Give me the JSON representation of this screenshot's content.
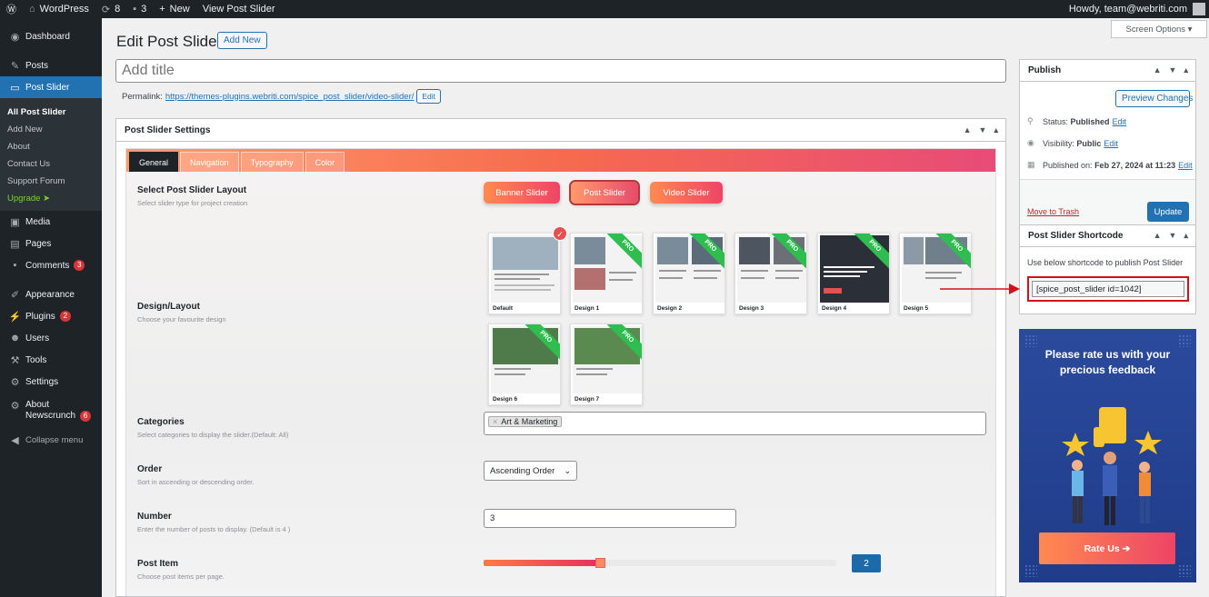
{
  "adminbar": {
    "site_name": "WordPress",
    "updates_count": "8",
    "comments_count": "3",
    "new_label": "New",
    "view_label": "View Post Slider",
    "howdy": "Howdy, team@webriti.com"
  },
  "sidebar": {
    "dashboard": "Dashboard",
    "posts": "Posts",
    "post_slider": "Post Slider",
    "submenu": [
      "All Post Slider",
      "Add New",
      "About",
      "Contact Us",
      "Support Forum",
      "Upgrade"
    ],
    "media": "Media",
    "pages": "Pages",
    "comments": "Comments",
    "comments_badge": "3",
    "appearance": "Appearance",
    "plugins": "Plugins",
    "plugins_badge": "2",
    "users": "Users",
    "tools": "Tools",
    "settings": "Settings",
    "about_newscrunch_1": "About",
    "about_newscrunch_2": "Newscrunch",
    "about_badge": "6",
    "collapse": "Collapse menu"
  },
  "header": {
    "title": "Edit Post Slider",
    "add_new": "Add New",
    "screen_options": "Screen Options"
  },
  "title_input": {
    "placeholder": "Add title"
  },
  "permalink": {
    "label": "Permalink:",
    "url": "https://themes-plugins.webriti.com/spice_post_slider/video-slider/",
    "edit": "Edit"
  },
  "settings": {
    "box_title": "Post Slider Settings",
    "tabs": [
      "General",
      "Navigation",
      "Typography",
      "Color"
    ],
    "layout_label": "Select Post Slider Layout",
    "layout_desc": "Select slider type for project creation",
    "layout_buttons": [
      "Banner Slider",
      "Post Slider",
      "Video Slider"
    ],
    "design_label": "Design/Layout",
    "design_desc": "Choose your favourite design",
    "designs": [
      "Default",
      "Design 1",
      "Design 2",
      "Design 3",
      "Design 4",
      "Design 5",
      "Design 6",
      "Design 7"
    ],
    "pro_label": "PRO",
    "categories_label": "Categories",
    "categories_desc": "Select categories to display the slider.(Default: All)",
    "category_tag": "Art & Marketing",
    "order_label": "Order",
    "order_desc": "Sort in ascending or descending order.",
    "order_value": "Ascending Order",
    "number_label": "Number",
    "number_desc": "Enter the number of posts to display. (Default is 4 )",
    "number_value": "3",
    "post_item_label": "Post Item",
    "post_item_desc": "Choose post items per page.",
    "post_item_value": "2",
    "post_item_fraction": 0.33
  },
  "publish": {
    "title": "Publish",
    "preview": "Preview Changes",
    "status_label": "Status:",
    "status_value": "Published",
    "visibility_label": "Visibility:",
    "visibility_value": "Public",
    "published_label": "Published on:",
    "published_value": "Feb 27, 2024 at 11:23",
    "edit": "Edit",
    "trash": "Move to Trash",
    "update": "Update"
  },
  "shortcode": {
    "title": "Post Slider Shortcode",
    "desc": "Use below shortcode to publish Post Slider",
    "value": "[spice_post_slider id=1042]"
  },
  "rate": {
    "line1": "Please rate us with your",
    "line2": "precious feedback",
    "button": "Rate Us ➔"
  },
  "colors": {
    "accent": "#2271b1",
    "admin_dark": "#1d2327",
    "brand_gradient_start": "#ff8a50",
    "brand_gradient_end": "#ee4466",
    "pro_green": "#2ebd4e"
  }
}
